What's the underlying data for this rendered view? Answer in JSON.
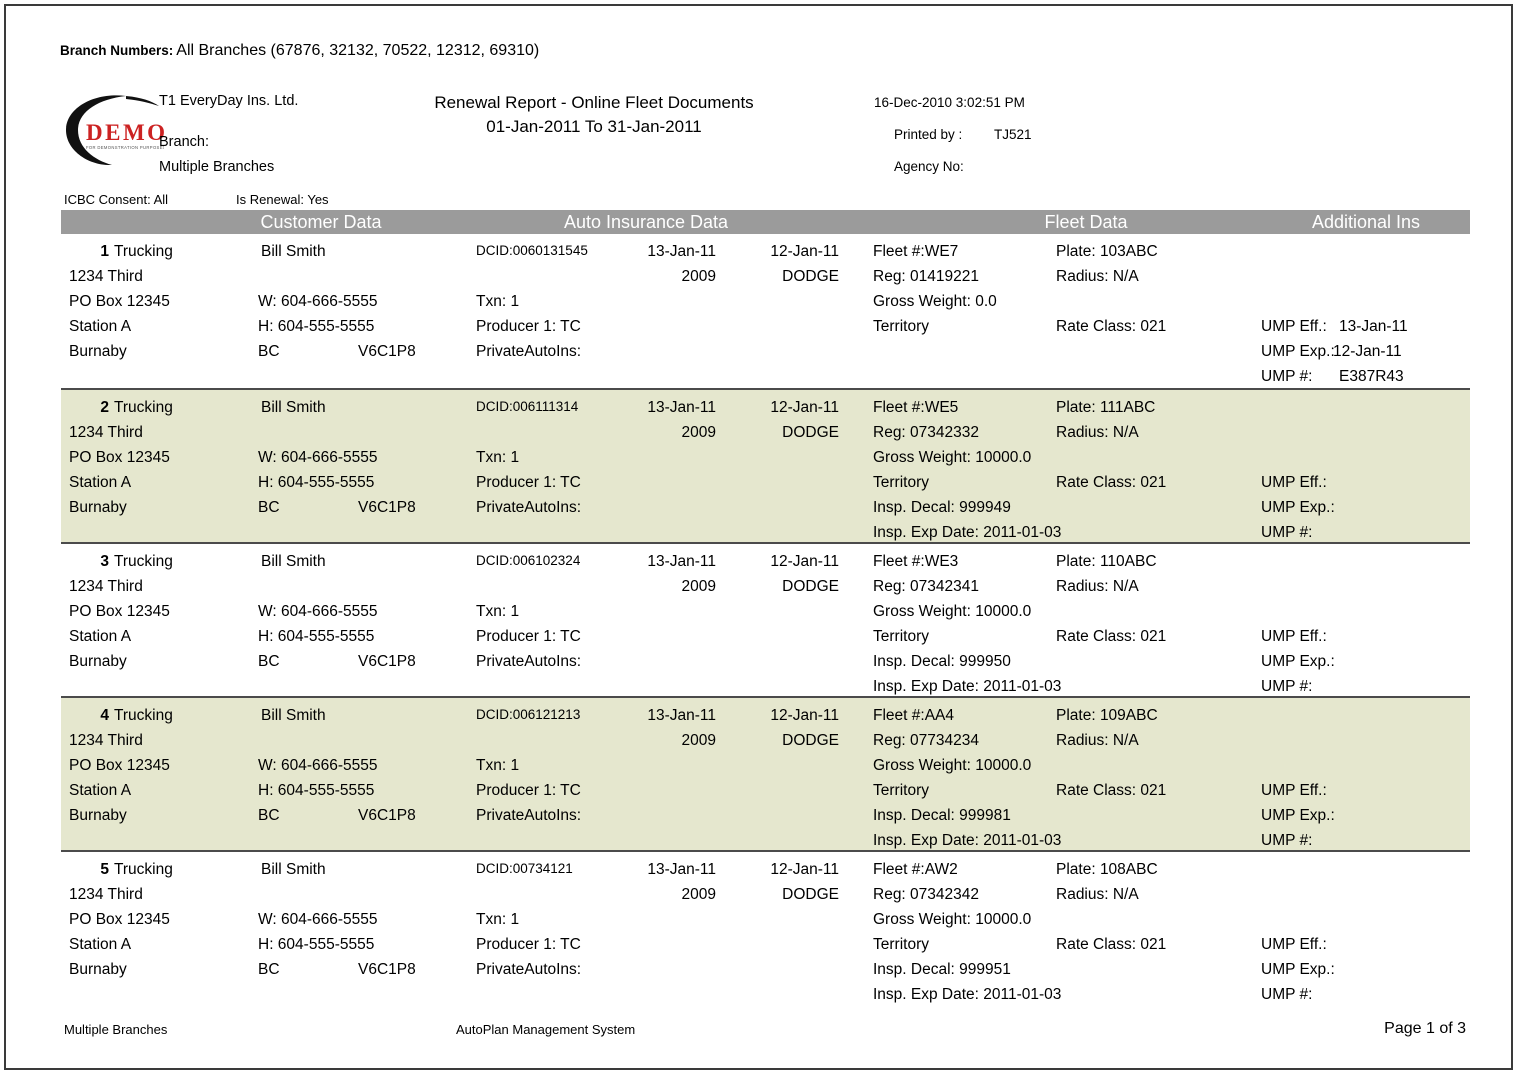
{
  "branch_numbers": {
    "label": "Branch Numbers:",
    "value": "All Branches (67876, 32132, 70522, 12312, 69310)"
  },
  "logo": {
    "word": "DEMO",
    "tagline": "FOR DEMONSTRATION PURPOSES ONLY",
    "word_color": "#cc2222",
    "swoosh_color": "#111111"
  },
  "header": {
    "company": "T1 EveryDay Ins. Ltd.",
    "branch_label": "Branch:",
    "branch_value": "Multiple Branches",
    "title": "Renewal Report - Online Fleet Documents",
    "subtitle": "01-Jan-2011 To 31-Jan-2011",
    "datetime": "16-Dec-2010 3:02:51 PM",
    "printed_by_label": "Printed by :",
    "printed_by_value": "TJ521",
    "agency_no_label": "Agency No:"
  },
  "filters": {
    "icbc_consent": "ICBC Consent: All",
    "is_renewal": "Is Renewal: Yes"
  },
  "section_headers": {
    "customer": "Customer Data",
    "auto": "Auto Insurance Data",
    "fleet": "Fleet Data",
    "additional": "Additional Ins",
    "bar_color": "#9b9b9b",
    "text_color": "#ffffff"
  },
  "alt_row_color": "#e5e7ce",
  "rows": [
    {
      "num": "1",
      "business": "Trucking",
      "address1": "1234 Third",
      "address2": "PO Box 12345",
      "address3": "Station A",
      "city": "Burnaby",
      "province": "BC",
      "postal": "V6C1P8",
      "contact": "Bill Smith",
      "phone_work": "W: 604-666-5555",
      "phone_home": "H: 604-555-5555",
      "dcid": "DCID:0060131545",
      "eff_date": "13-Jan-11",
      "exp_date": "12-Jan-11",
      "year": "2009",
      "make": "DODGE",
      "txn": "Txn: 1",
      "producer": "Producer 1: TC",
      "private_auto_ins": "PrivateAutoIns:",
      "fleet_no": "Fleet #:WE7",
      "reg": "Reg: 01419221",
      "gross_weight": "Gross Weight: 0.0",
      "territory": "Territory",
      "plate": "Plate: 103ABC",
      "radius": "Radius: N/A",
      "rate_class": "Rate Class: 021",
      "insp_decal": "",
      "insp_exp_date": "",
      "ump_eff_label": "UMP Eff.:",
      "ump_eff_value": "13-Jan-11",
      "ump_exp_label": "UMP Exp.:",
      "ump_exp_value": "12-Jan-11",
      "ump_num_label": "UMP #:",
      "ump_num_value": "E387R43",
      "highlighted": false
    },
    {
      "num": "2",
      "business": "Trucking",
      "address1": "1234 Third",
      "address2": "PO Box 12345",
      "address3": "Station A",
      "city": "Burnaby",
      "province": "BC",
      "postal": "V6C1P8",
      "contact": "Bill Smith",
      "phone_work": "W: 604-666-5555",
      "phone_home": "H: 604-555-5555",
      "dcid": "DCID:006111314",
      "eff_date": "13-Jan-11",
      "exp_date": "12-Jan-11",
      "year": "2009",
      "make": "DODGE",
      "txn": "Txn: 1",
      "producer": "Producer 1: TC",
      "private_auto_ins": "PrivateAutoIns:",
      "fleet_no": "Fleet #:WE5",
      "reg": "Reg: 07342332",
      "gross_weight": "Gross Weight: 10000.0",
      "territory": "Territory",
      "plate": "Plate: 111ABC",
      "radius": "Radius: N/A",
      "rate_class": "Rate Class: 021",
      "insp_decal": "Insp. Decal: 999949",
      "insp_exp_date": "Insp. Exp Date: 2011-01-03",
      "ump_eff_label": "UMP Eff.:",
      "ump_eff_value": "",
      "ump_exp_label": "UMP Exp.:",
      "ump_exp_value": "",
      "ump_num_label": "UMP #:",
      "ump_num_value": "",
      "highlighted": true
    },
    {
      "num": "3",
      "business": "Trucking",
      "address1": "1234 Third",
      "address2": "PO Box 12345",
      "address3": "Station A",
      "city": "Burnaby",
      "province": "BC",
      "postal": "V6C1P8",
      "contact": "Bill Smith",
      "phone_work": "W: 604-666-5555",
      "phone_home": "H: 604-555-5555",
      "dcid": "DCID:006102324",
      "eff_date": "13-Jan-11",
      "exp_date": "12-Jan-11",
      "year": "2009",
      "make": "DODGE",
      "txn": "Txn: 1",
      "producer": "Producer 1: TC",
      "private_auto_ins": "PrivateAutoIns:",
      "fleet_no": "Fleet #:WE3",
      "reg": "Reg: 07342341",
      "gross_weight": "Gross Weight: 10000.0",
      "territory": "Territory",
      "plate": "Plate: 110ABC",
      "radius": "Radius: N/A",
      "rate_class": "Rate Class: 021",
      "insp_decal": "Insp. Decal: 999950",
      "insp_exp_date": "Insp. Exp Date: 2011-01-03",
      "ump_eff_label": "UMP Eff.:",
      "ump_eff_value": "",
      "ump_exp_label": "UMP Exp.:",
      "ump_exp_value": "",
      "ump_num_label": "UMP #:",
      "ump_num_value": "",
      "highlighted": false
    },
    {
      "num": "4",
      "business": "Trucking",
      "address1": "1234 Third",
      "address2": "PO Box 12345",
      "address3": "Station A",
      "city": "Burnaby",
      "province": "BC",
      "postal": "V6C1P8",
      "contact": "Bill Smith",
      "phone_work": "W: 604-666-5555",
      "phone_home": "H: 604-555-5555",
      "dcid": "DCID:006121213",
      "eff_date": "13-Jan-11",
      "exp_date": "12-Jan-11",
      "year": "2009",
      "make": "DODGE",
      "txn": "Txn: 1",
      "producer": "Producer 1: TC",
      "private_auto_ins": "PrivateAutoIns:",
      "fleet_no": "Fleet #:AA4",
      "reg": "Reg: 07734234",
      "gross_weight": "Gross Weight: 10000.0",
      "territory": "Territory",
      "plate": "Plate: 109ABC",
      "radius": "Radius: N/A",
      "rate_class": "Rate Class: 021",
      "insp_decal": "Insp. Decal: 999981",
      "insp_exp_date": "Insp. Exp Date: 2011-01-03",
      "ump_eff_label": "UMP Eff.:",
      "ump_eff_value": "",
      "ump_exp_label": "UMP Exp.:",
      "ump_exp_value": "",
      "ump_num_label": "UMP #:",
      "ump_num_value": "",
      "highlighted": true
    },
    {
      "num": "5",
      "business": "Trucking",
      "address1": "1234 Third",
      "address2": "PO Box 12345",
      "address3": "Station A",
      "city": "Burnaby",
      "province": "BC",
      "postal": "V6C1P8",
      "contact": "Bill Smith",
      "phone_work": "W: 604-666-5555",
      "phone_home": "H: 604-555-5555",
      "dcid": "DCID:00734121",
      "eff_date": "13-Jan-11",
      "exp_date": "12-Jan-11",
      "year": "2009",
      "make": "DODGE",
      "txn": "Txn: 1",
      "producer": "Producer 1: TC",
      "private_auto_ins": "PrivateAutoIns:",
      "fleet_no": "Fleet #:AW2",
      "reg": "Reg: 07342342",
      "gross_weight": "Gross Weight: 10000.0",
      "territory": "Territory",
      "plate": "Plate: 108ABC",
      "radius": "Radius: N/A",
      "rate_class": "Rate Class: 021",
      "insp_decal": "Insp. Decal: 999951",
      "insp_exp_date": "Insp. Exp Date: 2011-01-03",
      "ump_eff_label": "UMP Eff.:",
      "ump_eff_value": "",
      "ump_exp_label": "UMP Exp.:",
      "ump_exp_value": "",
      "ump_num_label": "UMP #:",
      "ump_num_value": "",
      "highlighted": false
    }
  ],
  "footer": {
    "left": "Multiple Branches",
    "center": "AutoPlan Management System",
    "right": "Page 1 of  3"
  }
}
